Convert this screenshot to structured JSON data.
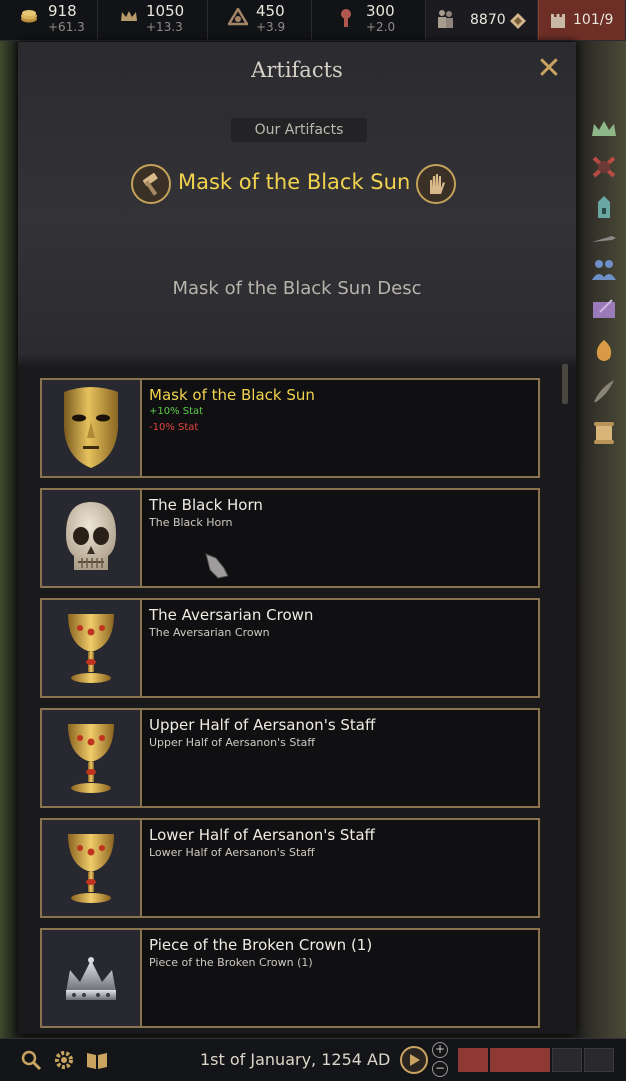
{
  "topbar": {
    "gold": {
      "value": "918",
      "change": "+61.3"
    },
    "prestige": {
      "value": "1050",
      "change": "+13.3"
    },
    "piety": {
      "value": "450",
      "change": "+3.9"
    },
    "renown": {
      "value": "300",
      "change": "+2.0"
    },
    "army": {
      "value": "8870"
    },
    "domain": {
      "value": "101/9"
    }
  },
  "panel": {
    "title": "Artifacts",
    "subtitle": "Our Artifacts",
    "featured": {
      "name": "Mask of the Black Sun",
      "description": "Mask of the Black Sun Desc",
      "left_icon": "hammer-icon",
      "right_icon": "hand-icon"
    }
  },
  "artifacts": [
    {
      "name": "Mask of the Black Sun",
      "stat_positive": "+10% Stat",
      "stat_negative": "-10% Stat",
      "icon": "golden-mask-icon"
    },
    {
      "name": "The Black Horn",
      "subtitle": "The Black Horn",
      "icon": "skull-icon"
    },
    {
      "name": "The Aversarian Crown",
      "subtitle": "The Aversarian Crown",
      "icon": "goblet-icon"
    },
    {
      "name": "Upper Half of Aersanon's Staff",
      "subtitle": "Upper Half of Aersanon's Staff",
      "icon": "goblet-icon"
    },
    {
      "name": "Lower Half of Aersanon's Staff",
      "subtitle": "Lower Half of Aersanon's Staff",
      "icon": "goblet-icon"
    },
    {
      "name": "Piece of the Broken Crown (1)",
      "subtitle": "Piece of the Broken Crown (1)",
      "icon": "crown-icon"
    }
  ],
  "sidebar": [
    "crown-icon",
    "war-icon",
    "building-icon",
    "sword-icon",
    "people-icon",
    "ledger-icon",
    "faith-icon",
    "quill-icon",
    "scroll-icon"
  ],
  "bottombar": {
    "date": "1st of January, 1254 AD",
    "icons": [
      "search-icon",
      "settings-icon",
      "encyclopedia-icon"
    ]
  },
  "colors": {
    "accent_gold": "#f2d34e",
    "border_gold": "#8a7450",
    "stat_positive": "#5ecb4a",
    "stat_negative": "#e2453a"
  }
}
